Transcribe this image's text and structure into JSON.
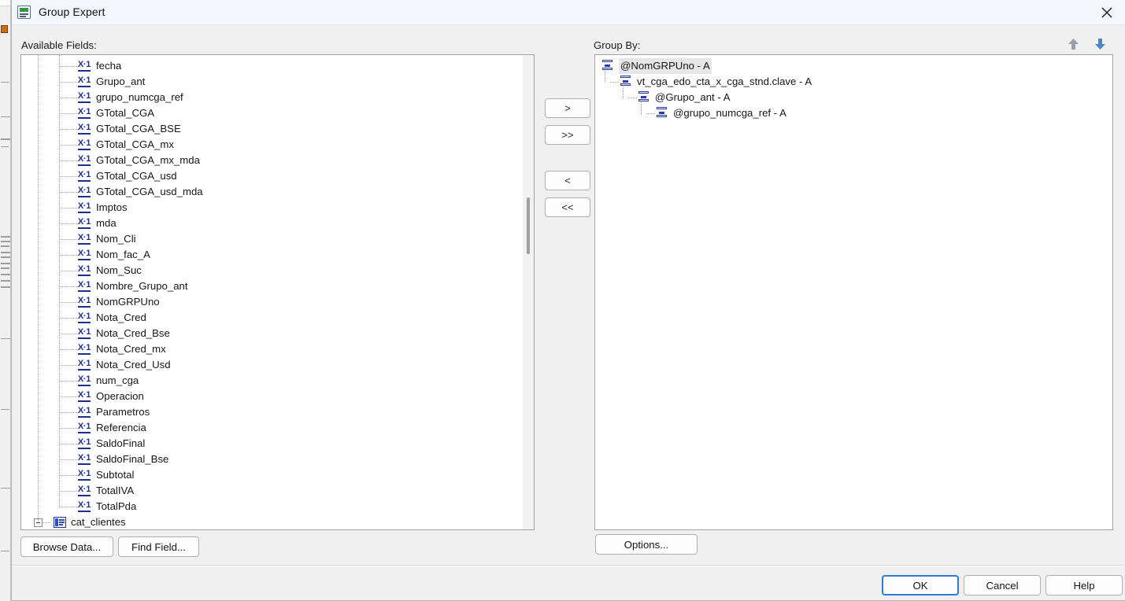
{
  "window": {
    "title": "Group Expert",
    "icon": "report-document-icon",
    "close_label": "✕"
  },
  "left_panel": {
    "label": "Available Fields:",
    "items": [
      {
        "name": "fecha",
        "icon": "formula-field-icon",
        "depth": 2
      },
      {
        "name": "Grupo_ant",
        "icon": "formula-field-icon",
        "depth": 2
      },
      {
        "name": "grupo_numcga_ref",
        "icon": "formula-field-icon",
        "depth": 2
      },
      {
        "name": "GTotal_CGA",
        "icon": "formula-field-icon",
        "depth": 2
      },
      {
        "name": "GTotal_CGA_BSE",
        "icon": "formula-field-icon",
        "depth": 2
      },
      {
        "name": "GTotal_CGA_mx",
        "icon": "formula-field-icon",
        "depth": 2
      },
      {
        "name": "GTotal_CGA_mx_mda",
        "icon": "formula-field-icon",
        "depth": 2
      },
      {
        "name": "GTotal_CGA_usd",
        "icon": "formula-field-icon",
        "depth": 2
      },
      {
        "name": "GTotal_CGA_usd_mda",
        "icon": "formula-field-icon",
        "depth": 2
      },
      {
        "name": "Imptos",
        "icon": "formula-field-icon",
        "depth": 2
      },
      {
        "name": "mda",
        "icon": "formula-field-icon",
        "depth": 2
      },
      {
        "name": "Nom_Cli",
        "icon": "formula-field-icon",
        "depth": 2
      },
      {
        "name": "Nom_fac_A",
        "icon": "formula-field-icon",
        "depth": 2
      },
      {
        "name": "Nom_Suc",
        "icon": "formula-field-icon",
        "depth": 2
      },
      {
        "name": "Nombre_Grupo_ant",
        "icon": "formula-field-icon",
        "depth": 2
      },
      {
        "name": "NomGRPUno",
        "icon": "formula-field-icon",
        "depth": 2
      },
      {
        "name": "Nota_Cred",
        "icon": "formula-field-icon",
        "depth": 2
      },
      {
        "name": "Nota_Cred_Bse",
        "icon": "formula-field-icon",
        "depth": 2
      },
      {
        "name": "Nota_Cred_mx",
        "icon": "formula-field-icon",
        "depth": 2
      },
      {
        "name": "Nota_Cred_Usd",
        "icon": "formula-field-icon",
        "depth": 2
      },
      {
        "name": "num_cga",
        "icon": "formula-field-icon",
        "depth": 2
      },
      {
        "name": "Operacion",
        "icon": "formula-field-icon",
        "depth": 2
      },
      {
        "name": "Parametros",
        "icon": "formula-field-icon",
        "depth": 2
      },
      {
        "name": "Referencia",
        "icon": "formula-field-icon",
        "depth": 2
      },
      {
        "name": "SaldoFinal",
        "icon": "formula-field-icon",
        "depth": 2
      },
      {
        "name": "SaldoFinal_Bse",
        "icon": "formula-field-icon",
        "depth": 2
      },
      {
        "name": "Subtotal",
        "icon": "formula-field-icon",
        "depth": 2
      },
      {
        "name": "TotalIVA",
        "icon": "formula-field-icon",
        "depth": 2
      },
      {
        "name": "TotalPda",
        "icon": "formula-field-icon",
        "depth": 2
      },
      {
        "name": "cat_clientes",
        "icon": "database-table-icon",
        "depth": 0,
        "expander": "collapsed"
      }
    ],
    "scrollbar": {
      "present": true,
      "thumb_top_pct": 30,
      "thumb_height_pct": 12
    },
    "buttons": [
      {
        "label": "Browse Data...",
        "name": "browse-data-button"
      },
      {
        "label": "Find Field...",
        "name": "find-field-button"
      }
    ]
  },
  "transfer_buttons": [
    {
      "label": ">",
      "name": "add-field-button"
    },
    {
      "label": ">>",
      "name": "add-all-fields-button"
    },
    {
      "label": "<",
      "name": "remove-field-button"
    },
    {
      "label": "<<",
      "name": "remove-all-fields-button"
    }
  ],
  "right_panel": {
    "label": "Group By:",
    "sort_up": {
      "name": "move-up-arrow",
      "state": "disabled",
      "color": "#9aa0a6"
    },
    "sort_down": {
      "name": "move-down-arrow",
      "state": "enabled",
      "color": "#4a86c8"
    },
    "items": [
      {
        "name": "@NomGRPUno - A",
        "icon": "group-icon",
        "depth": 0,
        "selected": true
      },
      {
        "name": "vt_cga_edo_cta_x_cga_stnd.clave - A",
        "icon": "group-icon",
        "depth": 1,
        "selected": false
      },
      {
        "name": "@Grupo_ant - A",
        "icon": "group-icon",
        "depth": 2,
        "selected": false
      },
      {
        "name": "@grupo_numcga_ref - A",
        "icon": "group-icon",
        "depth": 3,
        "selected": false
      }
    ],
    "options_button": {
      "label": "Options...",
      "name": "options-button"
    }
  },
  "footer_buttons": [
    {
      "label": "OK",
      "name": "ok-button",
      "default": true
    },
    {
      "label": "Cancel",
      "name": "cancel-button",
      "default": false
    },
    {
      "label": "Help",
      "name": "help-button",
      "default": false
    }
  ],
  "colors": {
    "titlebar": "#f3f6fb",
    "dialog_bg": "#f0f0f0",
    "listbox_bg": "#ffffff",
    "accent_blue": "#2a7fd4",
    "icon_blue": "#1d2f8f",
    "selection": "#e6e6e6"
  }
}
